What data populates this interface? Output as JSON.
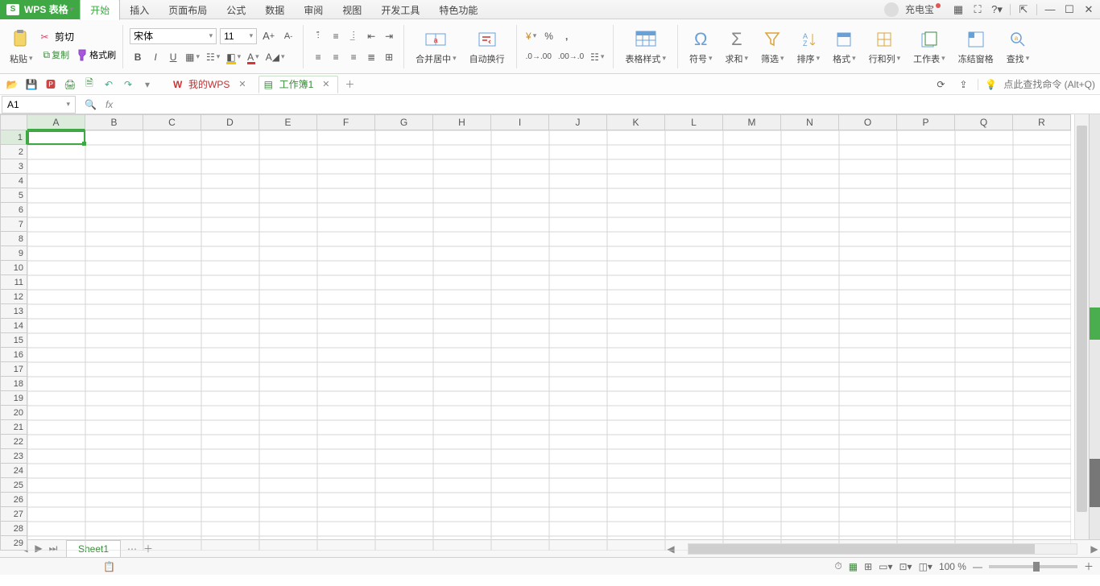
{
  "app": {
    "name": "WPS 表格"
  },
  "menu": {
    "tabs": [
      "开始",
      "插入",
      "页面布局",
      "公式",
      "数据",
      "审阅",
      "视图",
      "开发工具",
      "特色功能"
    ],
    "active": 0
  },
  "title_right": {
    "user": "充电宝",
    "help": "?"
  },
  "ribbon": {
    "paste": "粘贴",
    "cut": "剪切",
    "copy": "复制",
    "format_painter": "格式刷",
    "font_name": "宋体",
    "font_size": "11",
    "merge_center": "合并居中",
    "wrap_text": "自动换行",
    "table_style": "表格样式",
    "symbol": "符号",
    "sum": "求和",
    "filter": "筛选",
    "sort": "排序",
    "format": "格式",
    "rowcol": "行和列",
    "worksheet": "工作表",
    "freeze": "冻结窗格",
    "find": "查找"
  },
  "qat": {
    "doc_tabs": [
      {
        "label": "我的WPS",
        "active": false
      },
      {
        "label": "工作簿1",
        "active": true
      }
    ],
    "search_hint": "点此查找命令 (Alt+Q)"
  },
  "namebox": "A1",
  "columns": [
    "A",
    "B",
    "C",
    "D",
    "E",
    "F",
    "G",
    "H",
    "I",
    "J",
    "K",
    "L",
    "M",
    "N",
    "O",
    "P",
    "Q",
    "R"
  ],
  "rows": 29,
  "sheet": {
    "name": "Sheet1"
  },
  "status": {
    "zoom": "100 %"
  }
}
